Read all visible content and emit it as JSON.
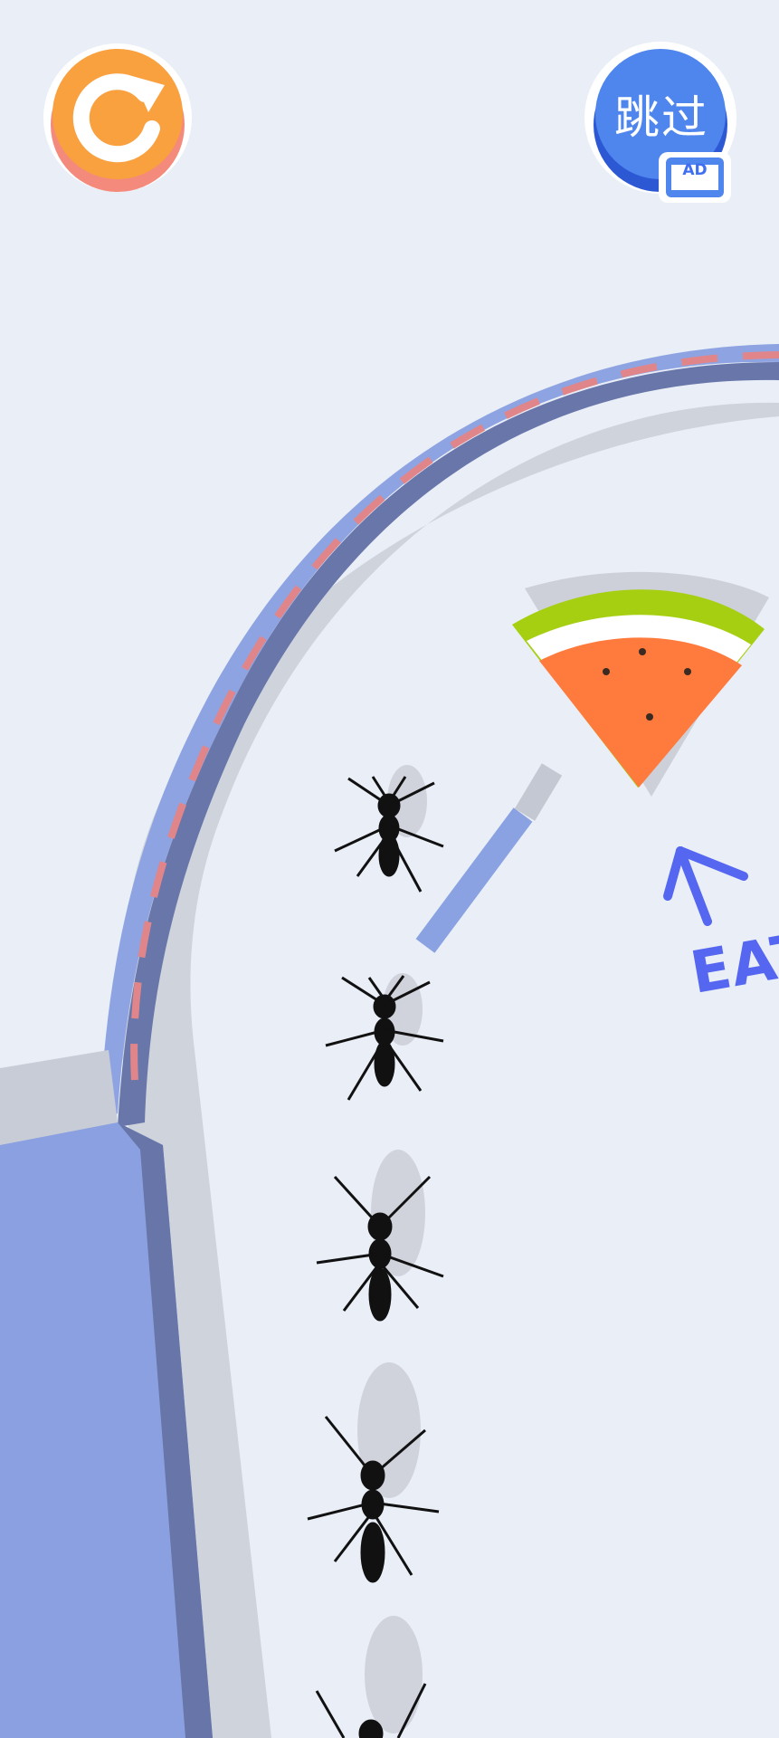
{
  "game": {
    "skip_label": "跳过",
    "ad_badge": "AD",
    "eat_label": "EAT"
  },
  "icons": {
    "restart": "restart-arrow-icon",
    "skip_ad": "ad-video-icon",
    "watermelon": "watermelon-slice-icon",
    "arrow": "up-left-arrow-icon",
    "ant": "ant-icon"
  },
  "colors": {
    "background": "#e9eef7",
    "wall": "#8ea3e2",
    "wall_dark": "#6775a8",
    "restart_orange": "#f9a03f",
    "skip_blue": "#4f86ee",
    "eat_text": "#5566f0",
    "watermelon_flesh": "#ff7a3d",
    "watermelon_rind": "#a6cf12"
  }
}
